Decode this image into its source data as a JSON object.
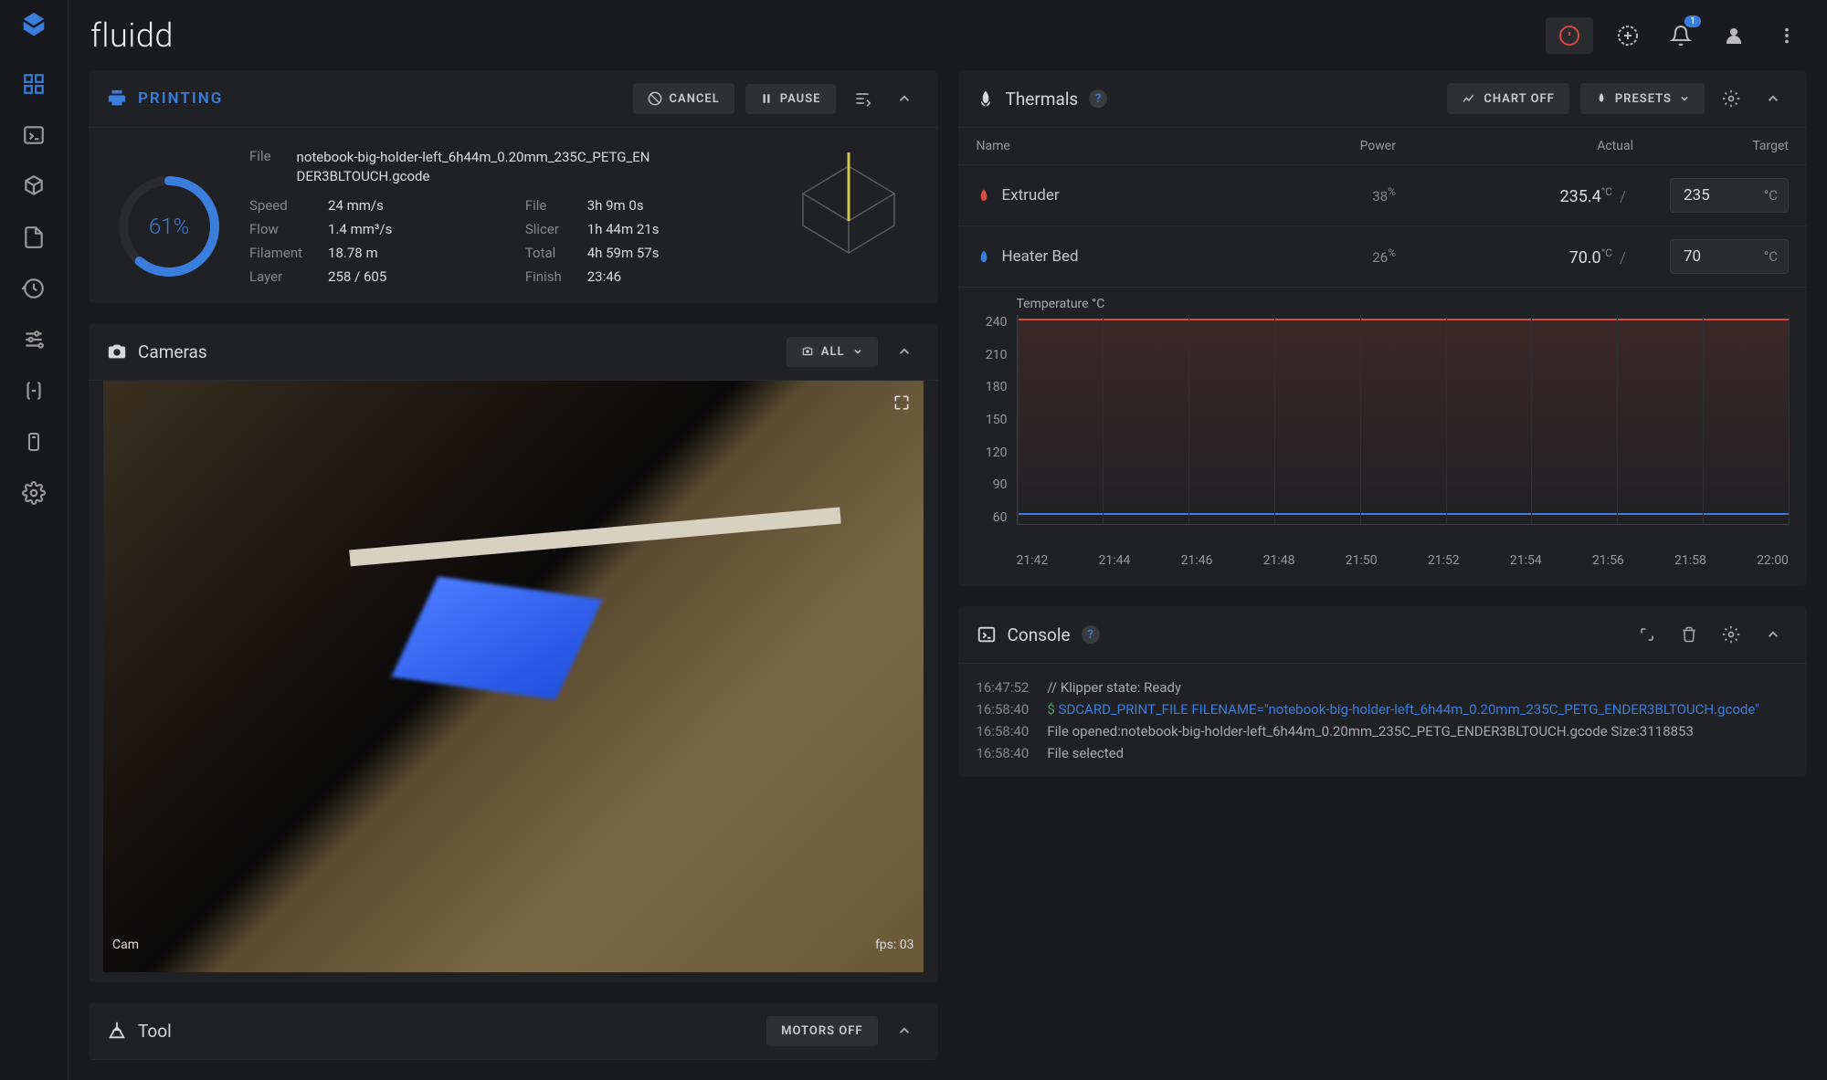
{
  "app": {
    "title": "fluidd",
    "notification_count": "1"
  },
  "printing": {
    "status": "PRINTING",
    "cancel": "CANCEL",
    "pause": "PAUSE",
    "progress": "61%",
    "progress_pct": 61,
    "file_label": "File",
    "file_name": "notebook-big-holder-left_6h44m_0.20mm_235C_PETG_EN DER3BLTOUCH.gcode",
    "stats": {
      "speed_lbl": "Speed",
      "speed": "24 mm/s",
      "flow_lbl": "Flow",
      "flow": "1.4 mm³/s",
      "filament_lbl": "Filament",
      "filament": "18.78 m",
      "layer_lbl": "Layer",
      "layer": "258 / 605",
      "file2_lbl": "File",
      "file_time": "3h 9m 0s",
      "slicer_lbl": "Slicer",
      "slicer": "1h 44m 21s",
      "total_lbl": "Total",
      "total": "4h 59m 57s",
      "finish_lbl": "Finish",
      "finish": "23:46"
    }
  },
  "cameras": {
    "title": "Cameras",
    "selector": "ALL",
    "label": "Cam",
    "fps": "fps: 03"
  },
  "tool": {
    "title": "Tool",
    "motors_off": "MOTORS OFF"
  },
  "thermals": {
    "title": "Thermals",
    "chart_off": "CHART OFF",
    "presets": "PRESETS",
    "headers": {
      "name": "Name",
      "power": "Power",
      "actual": "Actual",
      "target": "Target"
    },
    "rows": [
      {
        "name": "Extruder",
        "power": "38",
        "actual": "235.4",
        "target": "235",
        "icon": "ext"
      },
      {
        "name": "Heater Bed",
        "power": "26",
        "actual": "70.0",
        "target": "70",
        "icon": "bed"
      }
    ],
    "unit": "°C",
    "pct": "%"
  },
  "chart_data": {
    "type": "line",
    "title": "Temperature °C",
    "ylim": [
      60,
      240
    ],
    "y_ticks": [
      240,
      210,
      180,
      150,
      120,
      90,
      60
    ],
    "x_ticks": [
      "21:42",
      "21:44",
      "21:46",
      "21:48",
      "21:50",
      "21:52",
      "21:54",
      "21:56",
      "21:58",
      "22:00"
    ],
    "series": [
      {
        "name": "Extruder",
        "values": [
          235,
          235,
          235,
          235,
          235,
          235,
          235,
          235,
          235,
          235
        ],
        "color": "#d94a3e"
      },
      {
        "name": "Heater Bed",
        "values": [
          70,
          70,
          70,
          70,
          70,
          70,
          70,
          70,
          70,
          70
        ],
        "color": "#3b7ddd"
      }
    ]
  },
  "console": {
    "title": "Console",
    "lines": [
      {
        "time": "16:47:52",
        "text": "// Klipper state: Ready"
      },
      {
        "time": "16:58:40",
        "prompt": "$",
        "cmd": "SDCARD_PRINT_FILE FILENAME=\"notebook-big-holder-left_6h44m_0.20mm_235C_PETG_ENDER3BLTOUCH.gcode\""
      },
      {
        "time": "16:58:40",
        "text": "File opened:notebook-big-holder-left_6h44m_0.20mm_235C_PETG_ENDER3BLTOUCH.gcode Size:3118853"
      },
      {
        "time": "16:58:40",
        "text": "File selected"
      }
    ]
  }
}
